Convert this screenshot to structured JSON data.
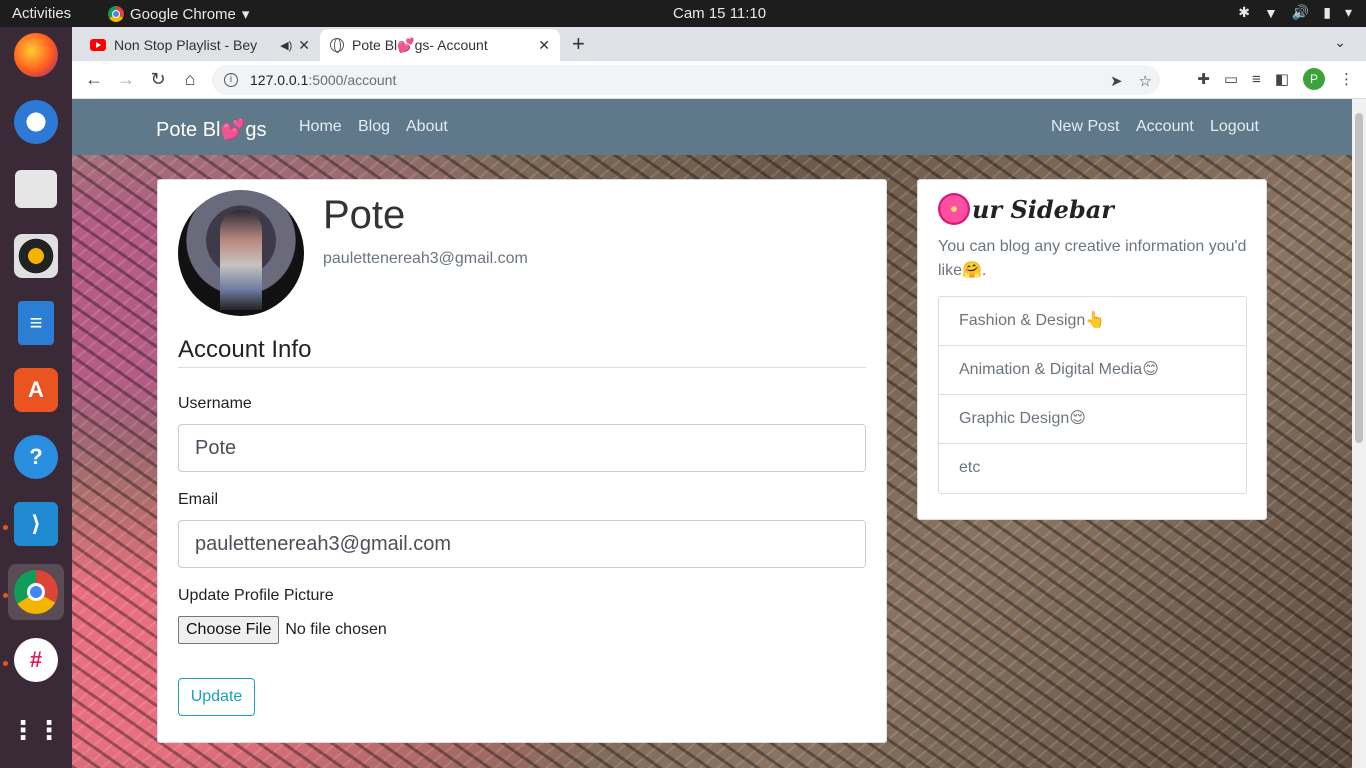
{
  "os": {
    "activities": "Activities",
    "app_menu": "Google Chrome",
    "clock": "Cam 15  11:10"
  },
  "browser": {
    "tabs": [
      {
        "title": "Non Stop Playlist - Bey",
        "icon": "youtube-icon",
        "audio": true
      },
      {
        "title": "Pote Bl💕gs- Account",
        "icon": "globe-icon",
        "active": true
      }
    ],
    "url_host": "127.0.0.1",
    "url_path": ":5000/account",
    "profile_initial": "P"
  },
  "site": {
    "brand": "Pote Bl💕gs",
    "nav_left": [
      "Home",
      "Blog",
      "About"
    ],
    "nav_right": [
      "New Post",
      "Account",
      "Logout"
    ]
  },
  "account": {
    "username": "Pote",
    "email": "paulettenereah3@gmail.com",
    "section_title": "Account Info",
    "username_label": "Username",
    "username_value": "Pote",
    "email_label": "Email",
    "email_value": "paulettenereah3@gmail.com",
    "picture_label": "Update Profile Picture",
    "choose_file": "Choose File",
    "no_file": "No file chosen",
    "update_button": "Update"
  },
  "sidebar": {
    "title": "ur Sidebar",
    "text": "You can blog any creative information you'd like🤗.",
    "items": [
      "Fashion & Design👆",
      "Animation & Digital Media😊",
      "Graphic Design😌",
      "etc"
    ]
  }
}
